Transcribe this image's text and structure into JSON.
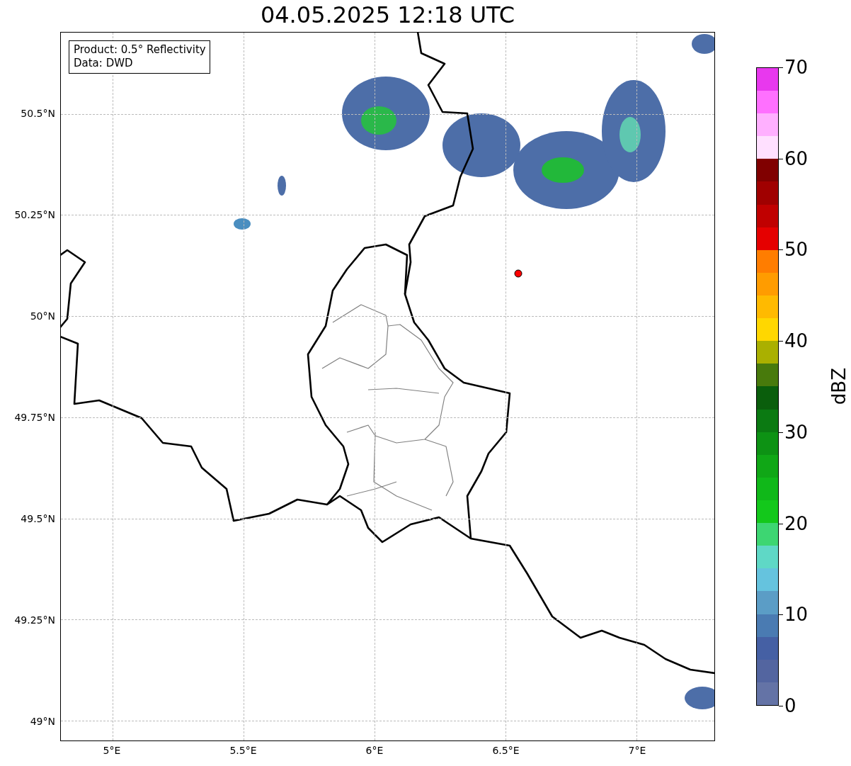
{
  "title": "04.05.2025 12:18 UTC",
  "legend": {
    "lines": [
      "Product: 0.5° Reflectivity",
      "Data: DWD"
    ]
  },
  "map": {
    "xticks": [
      "5°E",
      "5.5°E",
      "6°E",
      "6.5°E",
      "7°E"
    ],
    "yticks": [
      "50.5°N",
      "50.25°N",
      "50°N",
      "49.75°N",
      "49.5°N",
      "49.25°N",
      "49°N"
    ]
  },
  "colorbar": {
    "label": "dBZ",
    "ticks": [
      "70",
      "60",
      "50",
      "40",
      "30",
      "20",
      "10",
      "0"
    ],
    "bands": [
      {
        "color": "#6473a6"
      },
      {
        "color": "#5365a0"
      },
      {
        "color": "#4560a4"
      },
      {
        "color": "#4a7bb2"
      },
      {
        "color": "#5b9dc6"
      },
      {
        "color": "#65c3de"
      },
      {
        "color": "#5fd8c6"
      },
      {
        "color": "#3dd672"
      },
      {
        "color": "#13c81b"
      },
      {
        "color": "#10b819"
      },
      {
        "color": "#10a716"
      },
      {
        "color": "#0d9214"
      },
      {
        "color": "#0b7a12"
      },
      {
        "color": "#0a5e0c"
      },
      {
        "color": "#487a0c"
      },
      {
        "color": "#aab000"
      },
      {
        "color": "#ffd700"
      },
      {
        "color": "#ffba00"
      },
      {
        "color": "#ff9c00"
      },
      {
        "color": "#ff7d00"
      },
      {
        "color": "#e50000"
      },
      {
        "color": "#c00000"
      },
      {
        "color": "#a00000"
      },
      {
        "color": "#800000"
      },
      {
        "color": "#ffe0ff"
      },
      {
        "color": "#ffb0ff"
      },
      {
        "color": "#ff70ff"
      },
      {
        "color": "#e838ee"
      }
    ]
  }
}
